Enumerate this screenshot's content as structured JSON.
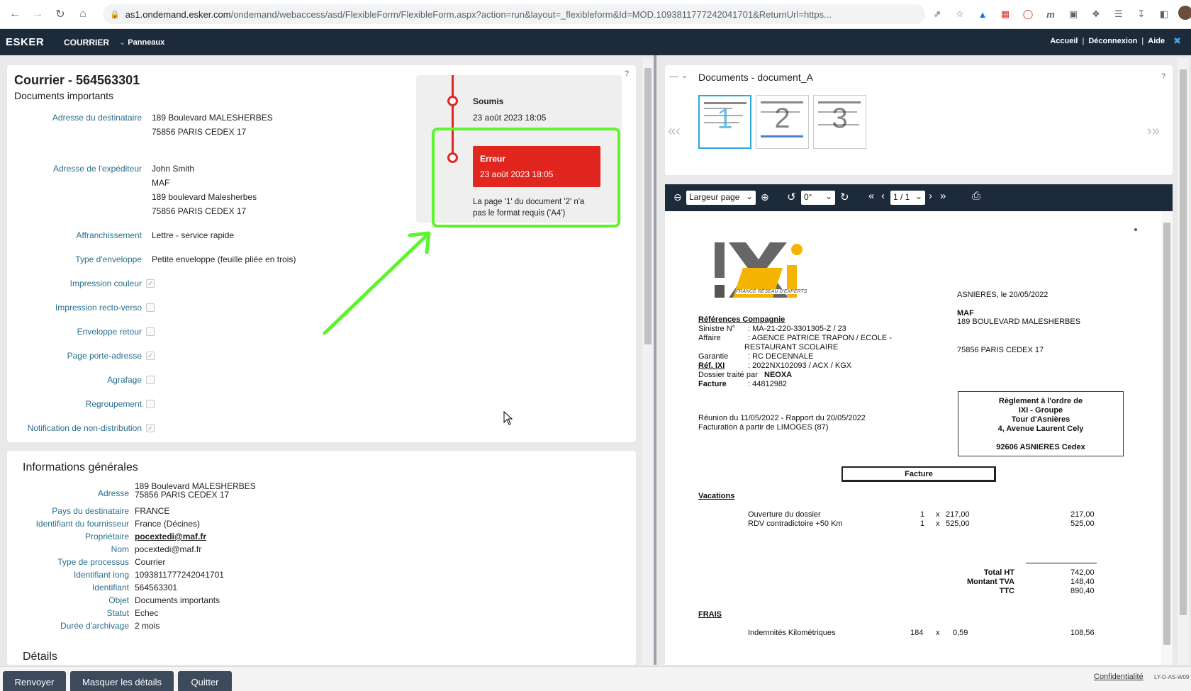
{
  "browser": {
    "url_host": "as1.ondemand.esker.com",
    "url_path": "/ondemand/webaccess/asd/FlexibleForm/FlexibleForm.aspx?action=run&layout=_flexibleform&Id=MOD.1093811777242041701&ReturnUrl=https..."
  },
  "app": {
    "logo": "ESKER",
    "name": "COURRIER",
    "panels": "Panneaux",
    "links": [
      "Accueil",
      "Déconnexion",
      "Aide"
    ]
  },
  "header": {
    "title": "Courrier - 564563301",
    "subtitle": "Documents importants",
    "help": "?"
  },
  "fields": {
    "dest_label": "Adresse du destinataire",
    "dest_line1": "189 Boulevard MALESHERBES",
    "dest_line2": "75856 PARIS CEDEX 17",
    "exp_label": "Adresse de l'expéditeur",
    "exp_line1": "John Smith",
    "exp_line2": "MAF",
    "exp_line3": "189 boulevard Malesherbes",
    "exp_line4": "75856 PARIS CEDEX 17",
    "affr_label": "Affranchissement",
    "affr_value": "Lettre - service rapide",
    "env_label": "Type d'enveloppe",
    "env_value": "Petite enveloppe (feuille pliée en trois)",
    "checks": [
      {
        "label": "Impression couleur",
        "checked": true
      },
      {
        "label": "Impression recto-verso",
        "checked": false
      },
      {
        "label": "Enveloppe retour",
        "checked": false
      },
      {
        "label": "Page porte-adresse",
        "checked": true
      },
      {
        "label": "Agrafage",
        "checked": false
      },
      {
        "label": "Regroupement",
        "checked": false
      },
      {
        "label": "Notification de non-distribution",
        "checked": true
      }
    ]
  },
  "timeline": {
    "step1_title": "Soumis",
    "step1_date": "23 août 2023 18:05",
    "step2_title": "Erreur",
    "step2_date": "23 août 2023 18:05",
    "step2_msg": "La page '1' du document '2' n'a pas le format requis ('A4')",
    "error_color": "#e0261f",
    "highlight_color": "#5cf52c"
  },
  "general": {
    "title": "Informations générales",
    "rows": [
      {
        "label": "Adresse",
        "value": "189 Boulevard MALESHERBES",
        "value2": "75856 PARIS CEDEX 17"
      },
      {
        "label": "Pays du destinataire",
        "value": "FRANCE"
      },
      {
        "label": "Identifiant du fournisseur",
        "value": "France (Décines)"
      },
      {
        "label": "Propriétaire",
        "value": "pocextedi@maf.fr"
      },
      {
        "label": "Nom",
        "value": "pocextedi@maf.fr"
      },
      {
        "label": "Type de processus",
        "value": "Courrier"
      },
      {
        "label": "Identifiant long",
        "value": "1093811777242041701"
      },
      {
        "label": "Identifiant",
        "value": "564563301"
      },
      {
        "label": "Objet",
        "value": "Documents importants"
      },
      {
        "label": "Statut",
        "value": "Echec"
      },
      {
        "label": "Durée d'archivage",
        "value": "2 mois"
      }
    ],
    "details_title": "Détails"
  },
  "documents": {
    "title": "Documents - document_A",
    "help": "?",
    "thumbs": [
      "1",
      "2",
      "3"
    ]
  },
  "viewer": {
    "zoom": "Largeur page",
    "rotation": "0°",
    "page": "1 / 1"
  },
  "invoice": {
    "logo": "IXi",
    "logo_sub": "FRANCE RÉSEAU D'EXPERTS",
    "city_date": "ASNIERES, le 20/05/2022",
    "to_name": "MAF",
    "to_addr": "189 BOULEVARD MALESHERBES",
    "to_city": "75856 PARIS CEDEX 17",
    "ref_title": "Références Compagnie",
    "sinistre_label": "Sinistre N°",
    "sinistre": ": MA-21-220-3301305-Z / 23",
    "affaire_label": "Affaire",
    "affaire1": ": AGENCE PATRICE TRAPON / ECOLE -",
    "affaire2": "RESTAURANT SCOLAIRE",
    "garantie_label": "Garantie",
    "garantie": ": RC DECENNALE",
    "refixi_label": "Réf. IXI",
    "refixi": ": 2022NX102093 / ACX / KGX",
    "dossier_label": "Dossier traité par",
    "dossier": "NEOXA",
    "facture_label": "Facture",
    "facture": ": 44812982",
    "reunion": "Réunion du 11/05/2022 - Rapport du 20/05/2022",
    "facturation": "Facturation à partir de LIMOGES (87)",
    "reglement1": "Règlement à l'ordre de",
    "reglement2": "IXI - Groupe",
    "reglement3": "Tour d'Asnières",
    "reglement4": "4, Avenue Laurent Cely",
    "reglement5": "92606 ASNIERES Cedex",
    "facture_box": "Facture",
    "vacations": "Vacations",
    "line1_desc": "Ouverture du dossier",
    "line1_qty": "1",
    "line1_x": "x",
    "line1_unit": "217,00",
    "line1_total": "217,00",
    "line2_desc": "RDV contradictoire +50 Km",
    "line2_qty": "1",
    "line2_x": "x",
    "line2_unit": "525,00",
    "line2_total": "525,00",
    "total_ht_label": "Total HT",
    "total_ht": "742,00",
    "tva_label": "Montant TVA",
    "tva": "148,40",
    "ttc_label": "TTC",
    "ttc": "890,40",
    "frais": "FRAIS",
    "km_desc": "Indemnités Kilométriques",
    "km_qty": "184",
    "km_x": "x",
    "km_unit": "0,59",
    "km_total": "108,56"
  },
  "footer": {
    "renvoyer": "Renvoyer",
    "masquer": "Masquer les détails",
    "quitter": "Quitter",
    "confidentialite": "Confidentialité",
    "code": "LY-D-AS-W09"
  }
}
